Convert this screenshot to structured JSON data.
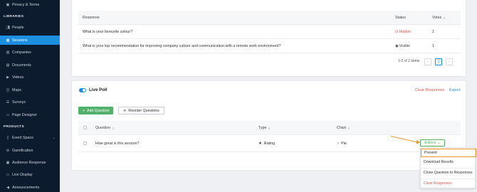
{
  "sidebar": {
    "top_item": {
      "label": "Privacy & Terms",
      "icon": "lock-icon"
    },
    "section_libraries": "LIBRARIES",
    "libraries": [
      {
        "label": "People",
        "icon": "people-icon"
      },
      {
        "label": "Sessions",
        "icon": "calendar-icon",
        "active": true
      },
      {
        "label": "Companies",
        "icon": "building-icon"
      },
      {
        "label": "Documents",
        "icon": "document-icon"
      },
      {
        "label": "Videos",
        "icon": "video-icon"
      },
      {
        "label": "Maps",
        "icon": "map-icon"
      },
      {
        "label": "Surveys",
        "icon": "survey-icon"
      },
      {
        "label": "Page Designer",
        "icon": "page-icon"
      }
    ],
    "section_products": "PRODUCTS",
    "products": [
      {
        "label": "Event Space",
        "icon": "device-icon",
        "has_chevron": true
      },
      {
        "label": "Gamification",
        "icon": "gear-icon"
      },
      {
        "label": "Audience Response",
        "icon": "response-icon"
      },
      {
        "label": "Live Display",
        "icon": "display-icon"
      },
      {
        "label": "Announcements",
        "icon": "megaphone-icon"
      }
    ]
  },
  "responses_table": {
    "columns": {
      "response": "Response",
      "status": "Status",
      "votes": "Votes"
    },
    "rows": [
      {
        "response": "What is your favourite colour?",
        "status": "Hidden",
        "status_icon": "eye-slash-icon",
        "votes": "1"
      },
      {
        "response": "What is your top recommendation for improving company culture and communication with a remote work environment?",
        "status": "Visible",
        "status_icon": "eye-icon",
        "votes": "1"
      }
    ],
    "pagination": {
      "summary": "1-2 of 2 items",
      "current_page": "1",
      "prev": "‹",
      "next": "›"
    }
  },
  "live_poll": {
    "title": "Live Poll",
    "enabled": true,
    "clear_responses": "Clear Responses",
    "export": "Export",
    "add_question": "Add Question",
    "reorder_questions": "Reorder Questions",
    "columns": {
      "question": "Question",
      "type": "Type",
      "chart": "Chart"
    },
    "rows": [
      {
        "question": "How great is this session?",
        "type": "Rating",
        "type_icon": "star-icon",
        "chart": "Pie",
        "chart_icon": "pie-icon",
        "actions": "Actions"
      }
    ]
  },
  "actions_menu": {
    "items": [
      "Present",
      "Download Results",
      "Close Question to Responses",
      "Clear Responses"
    ],
    "highlighted": "Present"
  },
  "colors": {
    "sidebar_bg": "#0d1b2e",
    "active": "#1d8fe1",
    "green": "#52b06a",
    "red": "#e0574f",
    "annotation": "#f0962a"
  }
}
